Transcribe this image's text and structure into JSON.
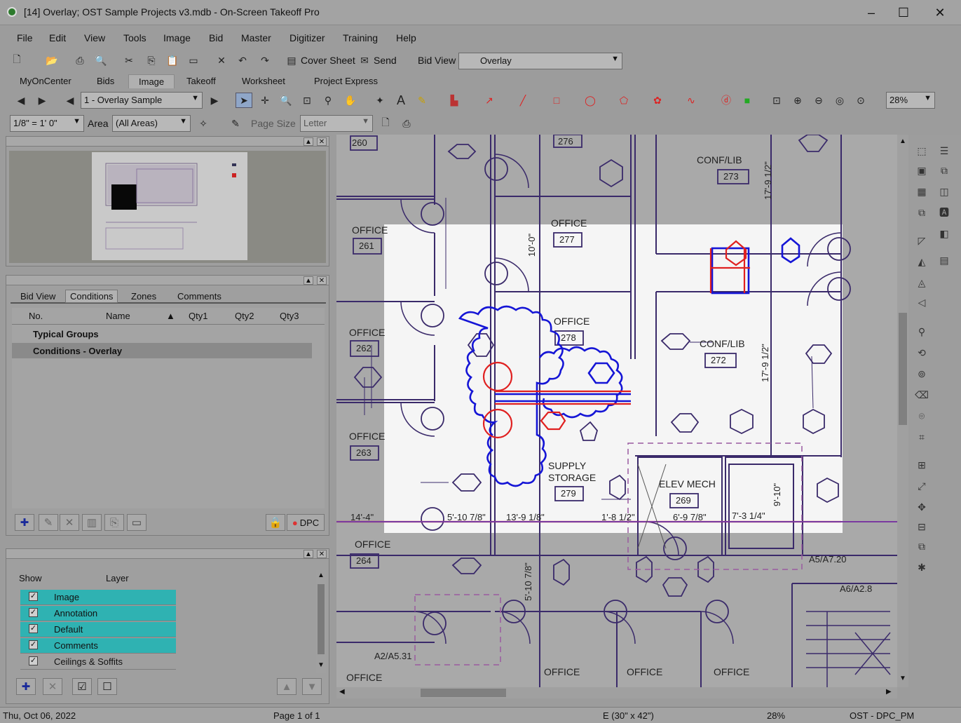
{
  "window": {
    "title": "[14] Overlay; OST Sample Projects v3.mdb - On-Screen Takeoff Pro",
    "minimize": "–",
    "maximize": "☐",
    "close": "✕"
  },
  "menu": [
    "File",
    "Edit",
    "View",
    "Tools",
    "Image",
    "Bid",
    "Master",
    "Digitizer",
    "Training",
    "Help"
  ],
  "toolbar1": {
    "cover_sheet": "Cover Sheet",
    "send": "Send",
    "bid_view_label": "Bid View",
    "bid_view_value": "Overlay"
  },
  "tabs": [
    "MyOnCenter",
    "Bids",
    "Image",
    "Takeoff",
    "Worksheet",
    "Project Express"
  ],
  "image_toolbar": {
    "page_select": "1 - Overlay Sample",
    "zoom": "28%"
  },
  "toolbar3": {
    "scale": "1/8\" = 1' 0\"",
    "area_label": "Area",
    "area_value": "(All Areas)",
    "page_size_label": "Page Size",
    "page_size_value": "Letter"
  },
  "conditions_panel": {
    "tabs": [
      "Bid View",
      "Conditions",
      "Zones",
      "Comments"
    ],
    "columns": [
      "No.",
      "Name",
      "Qty1",
      "Qty2",
      "Qty3"
    ],
    "rows": [
      {
        "name": "Typical Groups",
        "selected": false
      },
      {
        "name": "Conditions - Overlay",
        "selected": true
      }
    ],
    "dpc_label": "DPC"
  },
  "layers_panel": {
    "columns": [
      "Show",
      "Layer"
    ],
    "rows": [
      {
        "name": "Image",
        "checked": true,
        "highlight": true
      },
      {
        "name": "Annotation",
        "checked": true,
        "highlight": true
      },
      {
        "name": "Default",
        "checked": true,
        "highlight": true
      },
      {
        "name": "Comments",
        "checked": true,
        "highlight": true
      },
      {
        "name": "Ceilings & Soffits",
        "checked": true,
        "highlight": false
      }
    ]
  },
  "drawing": {
    "rooms": [
      {
        "label": "OFFICE",
        "num": "261"
      },
      {
        "label": "OFFICE",
        "num": "262"
      },
      {
        "label": "OFFICE",
        "num": "263"
      },
      {
        "label": "OFFICE",
        "num": "264"
      },
      {
        "label": "OFFICE",
        "num": "277"
      },
      {
        "label": "OFFICE",
        "num": "278"
      },
      {
        "label": "CONF/LIB",
        "num": "273"
      },
      {
        "label": "CONF/LIB",
        "num": "272"
      },
      {
        "label": "SUPPLY STORAGE",
        "num": "279"
      },
      {
        "label": "ELEV MECH",
        "num": "269"
      }
    ],
    "top_numbers": [
      "260",
      "276"
    ],
    "dims": [
      "14'-4\"",
      "5'-10 7/8\"",
      "13'-9 1/8\"",
      "1'-8 1/2\"",
      "6'-9 7/8\"",
      "7'-3 1/4\"",
      "9'-10\"",
      "17'-9 1/2\"",
      "17'-9 1/2\"",
      "5'-10 7/8\"",
      "10'-0\""
    ],
    "refs": [
      "A5/A7.20",
      "A6/A2.8",
      "A2/A5.31"
    ],
    "bottom_labels": [
      "OFFICE",
      "OFFICE",
      "OFFICE",
      "OFFICE"
    ]
  },
  "status": {
    "date": "Thu, Oct 06, 2022",
    "page": "Page 1 of 1",
    "sheet": "E (30\" x 42\")",
    "zoom": "28%",
    "user": "OST - DPC_PM"
  },
  "colors": {
    "accent_teal": "#2fb2b2",
    "markup_blue": "#1515d6",
    "markup_red": "#e02020",
    "drawing_line": "#3a2a6a"
  }
}
